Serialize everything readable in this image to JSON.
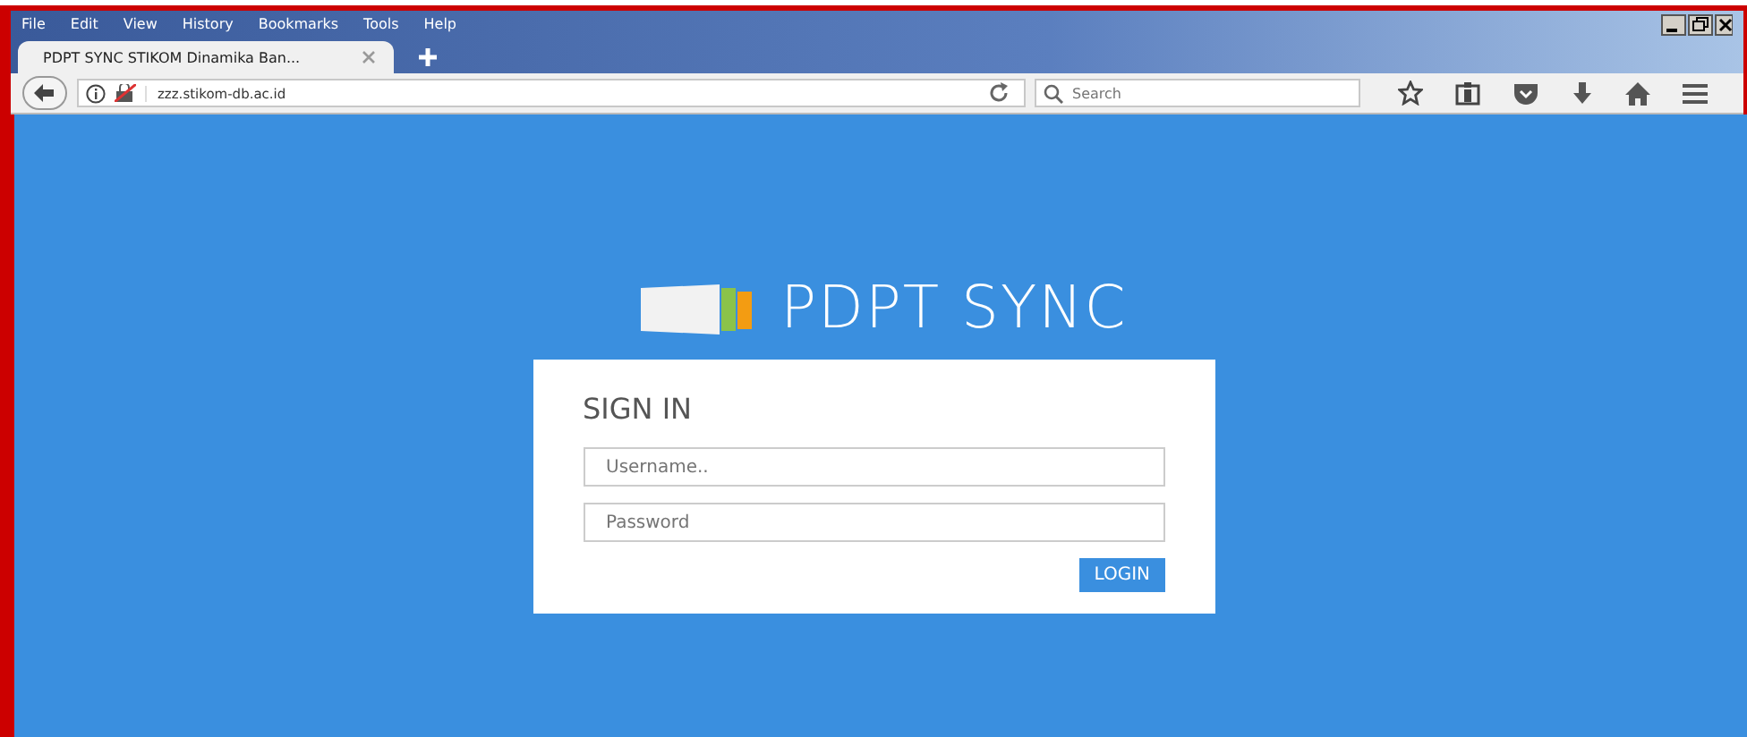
{
  "menu": [
    "File",
    "Edit",
    "View",
    "History",
    "Bookmarks",
    "Tools",
    "Help"
  ],
  "tabs": [
    {
      "title": "PDPT SYNC STIKOM Dinamika Ban...",
      "selected": true
    }
  ],
  "address_bar": {
    "value": "zzz.stikom-db.ac.id"
  },
  "search": {
    "placeholder": "Search"
  },
  "logo_text": "PDPT SYNC",
  "login": {
    "title": "SIGN IN",
    "username_placeholder": "Username..",
    "password_placeholder": "Password",
    "button": "LOGIN"
  }
}
